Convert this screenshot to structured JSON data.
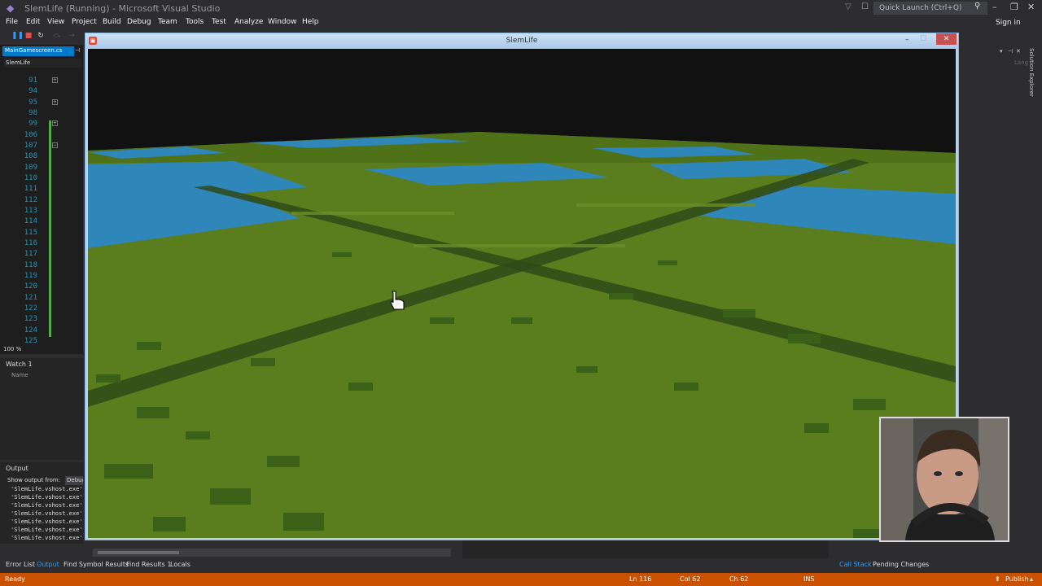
{
  "app": {
    "title": "SlemLife (Running) - Microsoft Visual Studio",
    "quick_launch_placeholder": "Quick Launch (Ctrl+Q)",
    "sign_in": "Sign in"
  },
  "menu": [
    "File",
    "Edit",
    "View",
    "Project",
    "Build",
    "Debug",
    "Team",
    "Tools",
    "Test",
    "Analyze",
    "Window",
    "Help"
  ],
  "editor": {
    "tab_label": "MainGamescreen.cs",
    "project_label": "SlemLife",
    "line_numbers": [
      "91",
      "94",
      "95",
      "98",
      "99",
      "106",
      "107",
      "108",
      "109",
      "110",
      "111",
      "112",
      "113",
      "114",
      "115",
      "116",
      "117",
      "118",
      "119",
      "120",
      "121",
      "122",
      "123",
      "124",
      "125"
    ],
    "zoom": "100 %"
  },
  "watch": {
    "title": "Watch 1",
    "column_name": "Name"
  },
  "output": {
    "title": "Output",
    "show_from_label": "Show output from:",
    "show_from_value": "Debug",
    "lines": [
      "'SlemLife.vshost.exe'",
      "'SlemLife.vshost.exe'",
      "'SlemLife.vshost.exe'",
      "'SlemLife.vshost.exe'",
      "'SlemLife.vshost.exe'",
      "'SlemLife.vshost.exe'",
      "'SlemLife.vshost.exe'"
    ]
  },
  "bottom_tabs": {
    "left": [
      "Error List",
      "Output",
      "Find Symbol Results",
      "Find Results 1",
      "Locals"
    ],
    "active": "Output",
    "right": [
      "Call Stack",
      "Pending Changes"
    ]
  },
  "status": {
    "ready": "Ready",
    "ln": "Ln 116",
    "col": "Col 62",
    "ch": "Ch 62",
    "ins": "INS",
    "publish": "Publish"
  },
  "right_panel": {
    "solution_explorer": "Solution Explorer",
    "lang": "Lang"
  },
  "game_window": {
    "title": "SlemLife"
  },
  "colors": {
    "vs_dark": "#2d2d30",
    "status_orange": "#ca5100",
    "accent_blue": "#007acc",
    "grass": "#5a7d1e",
    "dark_grass": "#3b6018",
    "water": "#2f86b8"
  }
}
